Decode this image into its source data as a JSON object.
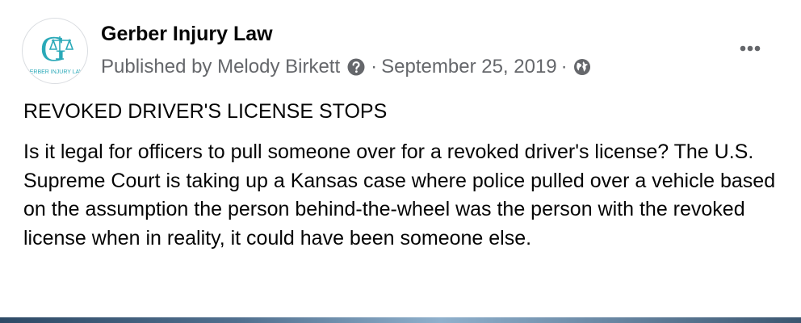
{
  "post": {
    "author": "Gerber Injury Law",
    "published_by": "Published by Melody Birkett",
    "date": "September 25, 2019",
    "separator": "·",
    "logo_text": "GERBER INJURY LAW",
    "logo_letter": "G",
    "title": "REVOKED DRIVER'S LICENSE STOPS",
    "body": "Is it legal for officers to pull someone over for a revoked driver's license? The U.S. Supreme Court is taking up a Kansas case where police pulled over a vehicle based on the assumption the person behind-the-wheel was the person with the revoked license when in reality, it could have been someone else."
  },
  "icons": {
    "info": "question-circle-icon",
    "audience": "globe-icon",
    "menu": "more-options-icon"
  },
  "colors": {
    "logo_teal": "#2aa9b8",
    "meta_gray": "#65676b",
    "text": "#050505"
  }
}
